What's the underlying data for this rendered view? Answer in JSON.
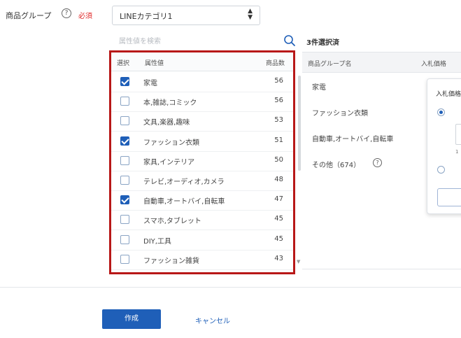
{
  "form": {
    "label": "商品グループ",
    "help_icon": "?",
    "required": "必須"
  },
  "category_select": {
    "value": "LINEカテゴリ1",
    "arrow_icon": "updown-arrows"
  },
  "search": {
    "placeholder": "属性値を検索",
    "icon": "search-icon"
  },
  "attribute_list": {
    "headers": {
      "select": "選択",
      "attribute": "属性値",
      "count": "商品数"
    },
    "rows": [
      {
        "label": "家電",
        "count": "56",
        "checked": true
      },
      {
        "label": "本,雑誌,コミック",
        "count": "56",
        "checked": false
      },
      {
        "label": "文具,楽器,趣味",
        "count": "53",
        "checked": false
      },
      {
        "label": "ファッション衣類",
        "count": "51",
        "checked": true
      },
      {
        "label": "家具,インテリア",
        "count": "50",
        "checked": false
      },
      {
        "label": "テレビ,オーディオ,カメラ",
        "count": "48",
        "checked": false
      },
      {
        "label": "自動車,オートバイ,自転車",
        "count": "47",
        "checked": true
      },
      {
        "label": "スマホ,タブレット",
        "count": "45",
        "checked": false
      },
      {
        "label": "DIY,工具",
        "count": "45",
        "checked": false
      },
      {
        "label": "ファッション雑貨",
        "count": "43",
        "checked": false
      }
    ]
  },
  "selected_panel": {
    "title": "3件選択済",
    "headers": {
      "name": "商品グループ名",
      "bid": "入札価格"
    },
    "items": [
      "家電",
      "ファッション衣類",
      "自動車,オートバイ,自転車",
      "その他（674）"
    ],
    "help_icon": "?"
  },
  "popover": {
    "title": "入札価格",
    "small_text": "1"
  },
  "footer": {
    "create_label": "作成",
    "cancel_label": "キャンセル"
  },
  "colors": {
    "accent": "#1f5fb8",
    "highlight_border": "#b81818",
    "required": "#e02a2a"
  }
}
